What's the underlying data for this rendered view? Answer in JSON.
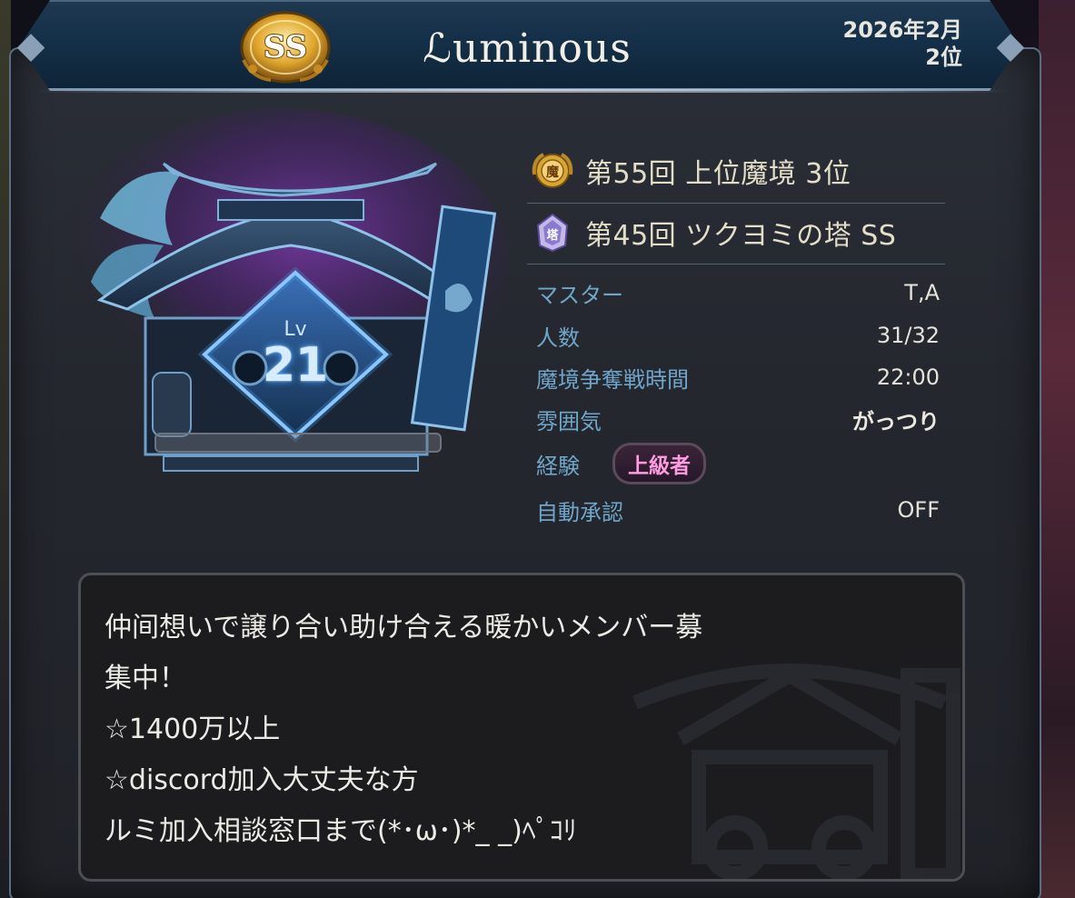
{
  "header": {
    "rank_badge": "SS",
    "guild_name": "ℒuminous",
    "date": "2026年2月",
    "rank_position": "2位"
  },
  "emblem": {
    "level_label": "Lv",
    "level": "21",
    "progress": 0.0
  },
  "achievements": [
    {
      "icon": "laurel-medal-icon",
      "text": "第55回 上位魔境 3位"
    },
    {
      "icon": "tower-crest-icon",
      "text": "第45回 ツクヨミの塔 SS"
    }
  ],
  "info": {
    "master_label": "マスター",
    "master_value": "T,A",
    "members_label": "人数",
    "members_value": "31/32",
    "battle_time_label": "魔境争奪戦時間",
    "battle_time_value": "22:00",
    "atmosphere_label": "雰囲気",
    "atmosphere_value": "がっつり",
    "experience_label": "経験",
    "experience_value": "上級者",
    "auto_approve_label": "自動承認",
    "auto_approve_value": "OFF"
  },
  "description": {
    "lines": [
      "仲间想いで譲り合い助け合える暖かいメンバー募",
      "集中！",
      "☆1400万以上",
      "☆discord加入大丈夫な方",
      "ルミ加入相談窓口まで(*･ω･)*_ _)ﾍﾟｺﾘ"
    ]
  },
  "colors": {
    "label_blue": "#6fa6c9",
    "experience_pink": "#ff9be0",
    "gold": "#d8a634",
    "banner_blue": "#143048"
  }
}
